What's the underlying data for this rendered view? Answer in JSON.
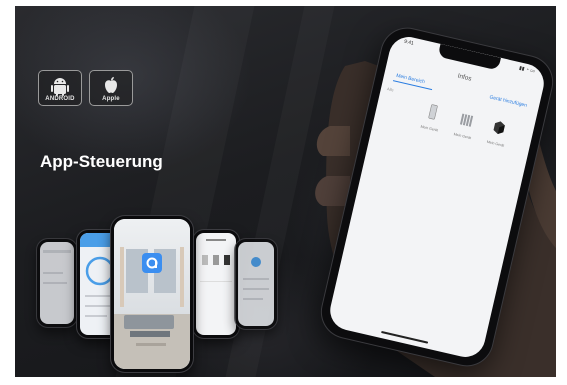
{
  "os_badges": {
    "android_caption": "ANDROID",
    "apple_caption": "Apple"
  },
  "headline": "App-Steuerung",
  "big_phone": {
    "status_left": "9:41",
    "app_title": "Infos",
    "tab_left": "Mein Bereich",
    "tab_right": "Gerät hinzufügen",
    "side_label": "Alle",
    "devices": [
      {
        "label": "Mein Gerät",
        "icon": "door-sensor-icon"
      },
      {
        "label": "Mein Gerät",
        "icon": "radiator-icon"
      },
      {
        "label": "Mein Gerät",
        "icon": "box-icon"
      }
    ]
  },
  "colors": {
    "background": "#1c1d20",
    "app_accent": "#2a7de1",
    "app_logo": "#3b8ef0"
  }
}
